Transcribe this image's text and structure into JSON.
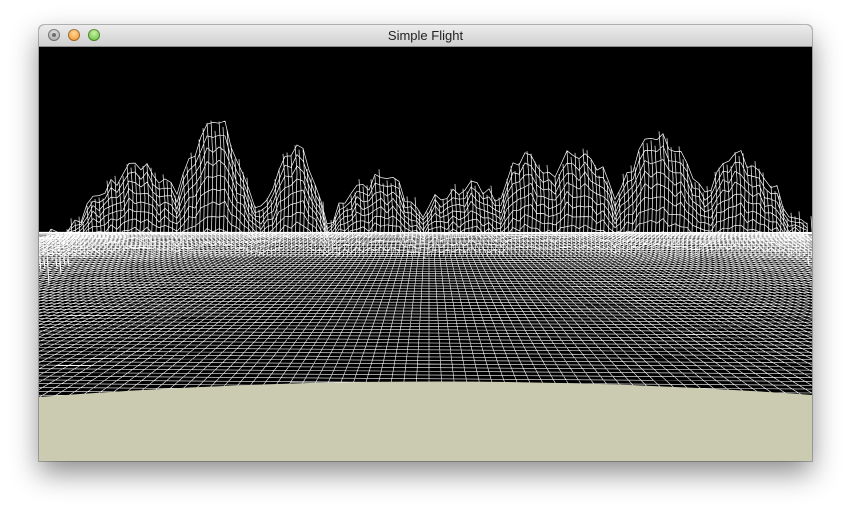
{
  "window": {
    "title": "Simple Flight",
    "traffic_lights": [
      "close-button",
      "minimize-button",
      "zoom-button"
    ]
  },
  "scene": {
    "sky_color": "#000000",
    "wireframe_color": "#ffffff",
    "ground_color": "#cbcbb1"
  }
}
